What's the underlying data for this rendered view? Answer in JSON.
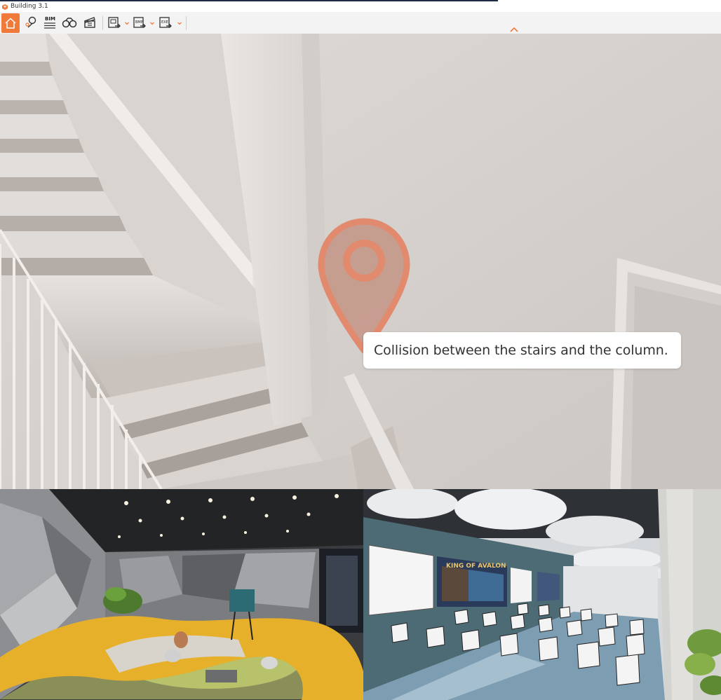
{
  "window": {
    "title": "Building 3.1"
  },
  "toolbar": {
    "accent": "#f07a3a",
    "buttons": [
      {
        "name": "home",
        "icon": "home-icon",
        "active": true
      },
      {
        "name": "location",
        "icon": "location-pin-icon"
      },
      {
        "name": "bim",
        "icon": "bim-icon",
        "label": "BIM"
      },
      {
        "name": "view",
        "icon": "binoculars-icon"
      },
      {
        "name": "clapper",
        "icon": "clapperboard-icon"
      },
      {
        "name": "export-image",
        "icon": "export-image-icon",
        "has_dropdown": true
      },
      {
        "name": "export-bmp",
        "icon": "export-bmp-icon",
        "label": "BMP",
        "has_dropdown": true
      },
      {
        "name": "export-exe",
        "icon": "export-exe-icon",
        "label": "EXE",
        "has_dropdown": true
      }
    ]
  },
  "viewport": {
    "pin_icon": "location-pin-icon",
    "annotation_text": "Collision between the stairs and the column."
  },
  "gallery": {
    "left_image": "rendered-lounge-image",
    "right_image": "rendered-auditorium-image",
    "screen_text": "KING OF AVALON"
  }
}
